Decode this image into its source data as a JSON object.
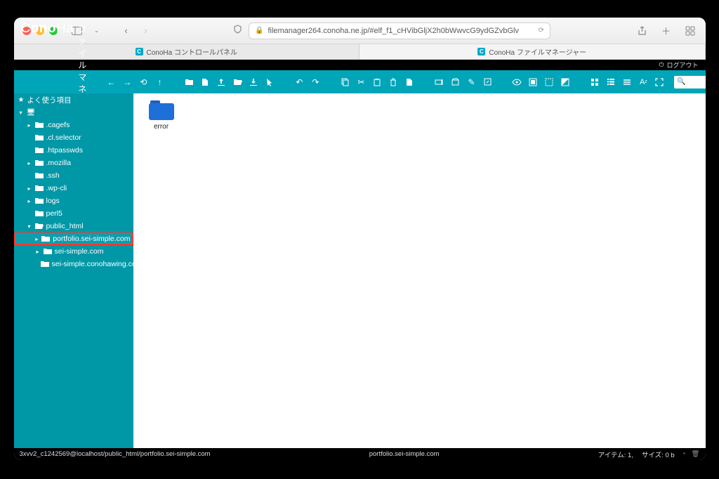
{
  "browser": {
    "url": "filemanager264.conoha.ne.jp/#elf_f1_cHVibGljX2h0bWwvcG9ydGZvbGlv",
    "tabs": [
      {
        "label": "ConoHa コントロールパネル",
        "active": false
      },
      {
        "label": "ConoHa ファイルマネージャー",
        "active": true
      }
    ]
  },
  "topstrip": {
    "logout": "ログアウト"
  },
  "header": {
    "logo_text": "ConoHa",
    "app_title": "ファイルマネージャー"
  },
  "toolbar_icons": [
    "nav-back",
    "nav-forward",
    "nav-reload",
    "nav-up",
    "gap",
    "new-folder",
    "new-file",
    "upload",
    "open",
    "download",
    "pointer",
    "gap",
    "undo",
    "redo",
    "gap",
    "copy",
    "cut",
    "paste",
    "delete",
    "duplicate",
    "gap",
    "rename",
    "archive",
    "edit",
    "resize",
    "gap",
    "preview",
    "select-all",
    "select-none",
    "select-invert",
    "gap",
    "view-icons",
    "view-list",
    "view-detail",
    "sort",
    "encoding",
    "fullscreen"
  ],
  "sidebar": {
    "favorites_label": "よく使う項目",
    "root": {
      "items": [
        {
          "name": ".cagefs",
          "expandable": true,
          "depth": 1
        },
        {
          "name": ".cl.selector",
          "expandable": false,
          "depth": 1
        },
        {
          "name": ".htpasswds",
          "expandable": false,
          "depth": 1
        },
        {
          "name": ".mozilla",
          "expandable": true,
          "depth": 1
        },
        {
          "name": ".ssh",
          "expandable": false,
          "depth": 1
        },
        {
          "name": ".wp-cli",
          "expandable": true,
          "depth": 1
        },
        {
          "name": "logs",
          "expandable": true,
          "depth": 1
        },
        {
          "name": "perl5",
          "expandable": false,
          "depth": 1
        },
        {
          "name": "public_html",
          "expandable": true,
          "expanded": true,
          "depth": 1,
          "children": [
            {
              "name": "portfolio.sei-simple.com",
              "expandable": true,
              "depth": 2,
              "selected": true
            },
            {
              "name": "sei-simple.com",
              "expandable": true,
              "depth": 2
            },
            {
              "name": "sei-simple.conohawing.com",
              "expandable": false,
              "depth": 2
            }
          ]
        }
      ]
    }
  },
  "content": {
    "items": [
      {
        "name": "error",
        "type": "folder"
      }
    ]
  },
  "statusbar": {
    "path": "3xvv2_c1242569@localhost/public_html/portfolio.sei-simple.com",
    "current": "portfolio.sei-simple.com",
    "items_label": "アイテム:",
    "items_count": "1,",
    "size_label": "サイズ:",
    "size_value": "0 b"
  }
}
